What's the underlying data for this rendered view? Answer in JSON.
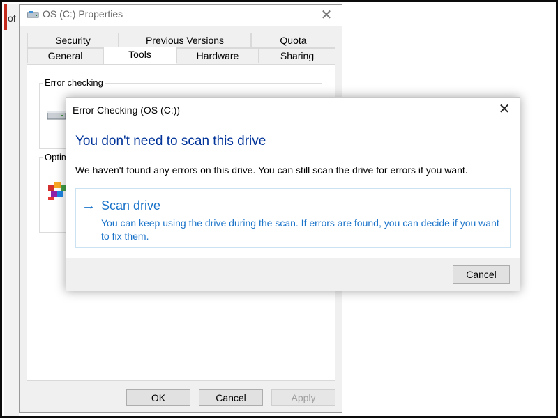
{
  "background_window": {
    "partial_text": "of"
  },
  "properties_window": {
    "title": "OS (C:) Properties",
    "tabs_row1": [
      "Security",
      "Previous Versions",
      "Quota"
    ],
    "tabs_row2": [
      "General",
      "Tools",
      "Hardware",
      "Sharing"
    ],
    "active_tab": "Tools",
    "error_checking_group": {
      "label": "Error checking"
    },
    "optimize_group": {
      "label": "Optim"
    },
    "buttons": {
      "ok": "OK",
      "cancel": "Cancel",
      "apply": "Apply"
    }
  },
  "dialog": {
    "title": "Error Checking (OS (C:))",
    "heading": "You don't need to scan this drive",
    "message": "We haven't found any errors on this drive. You can still scan the drive for errors if you want.",
    "scan_option": {
      "arrow": "→",
      "title": "Scan drive",
      "description": "You can keep using the drive during the scan. If errors are found, you can decide if you want to fix them."
    },
    "cancel_label": "Cancel"
  },
  "icons": {
    "close": "✕"
  },
  "colors": {
    "heading_blue": "#003399",
    "link_blue": "#1a73c9",
    "accent_red": "#c42b1c"
  }
}
